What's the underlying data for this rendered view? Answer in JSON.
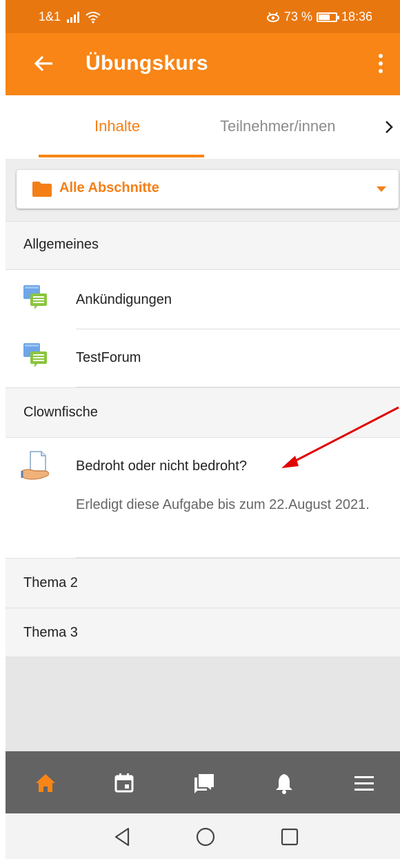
{
  "status_bar": {
    "carrier": "1&1",
    "battery_percent": "73 %",
    "time": "18:36",
    "battery_level": 0.73
  },
  "app_bar": {
    "title": "Übungskurs"
  },
  "tabs": [
    {
      "label": "Inhalte",
      "active": true
    },
    {
      "label": "Teilnehmer/innen",
      "active": false
    }
  ],
  "section_selector": {
    "label": "Alle Abschnitte"
  },
  "sections": [
    {
      "title": "Allgemeines",
      "items": [
        {
          "label": "Ankündigungen",
          "icon": "forum-icon"
        },
        {
          "label": "TestForum",
          "icon": "forum-icon"
        }
      ]
    },
    {
      "title": "Clownfische",
      "items": [
        {
          "label": "Bedroht oder nicht bedroht?",
          "icon": "assignment-icon",
          "description": "Erledigt diese Aufgabe bis zum 22.August 2021."
        }
      ]
    },
    {
      "title": "Thema 2",
      "items": []
    },
    {
      "title": "Thema 3",
      "items": []
    }
  ],
  "bottom_nav": [
    {
      "icon": "home-icon",
      "active": true
    },
    {
      "icon": "calendar-icon",
      "active": false
    },
    {
      "icon": "messages-icon",
      "active": false
    },
    {
      "icon": "bell-icon",
      "active": false
    },
    {
      "icon": "menu-icon",
      "active": false
    }
  ],
  "colors": {
    "accent": "#f88515",
    "status_bar": "#e8770f",
    "bottom_nav": "#636363",
    "annotation": "#e00000"
  }
}
